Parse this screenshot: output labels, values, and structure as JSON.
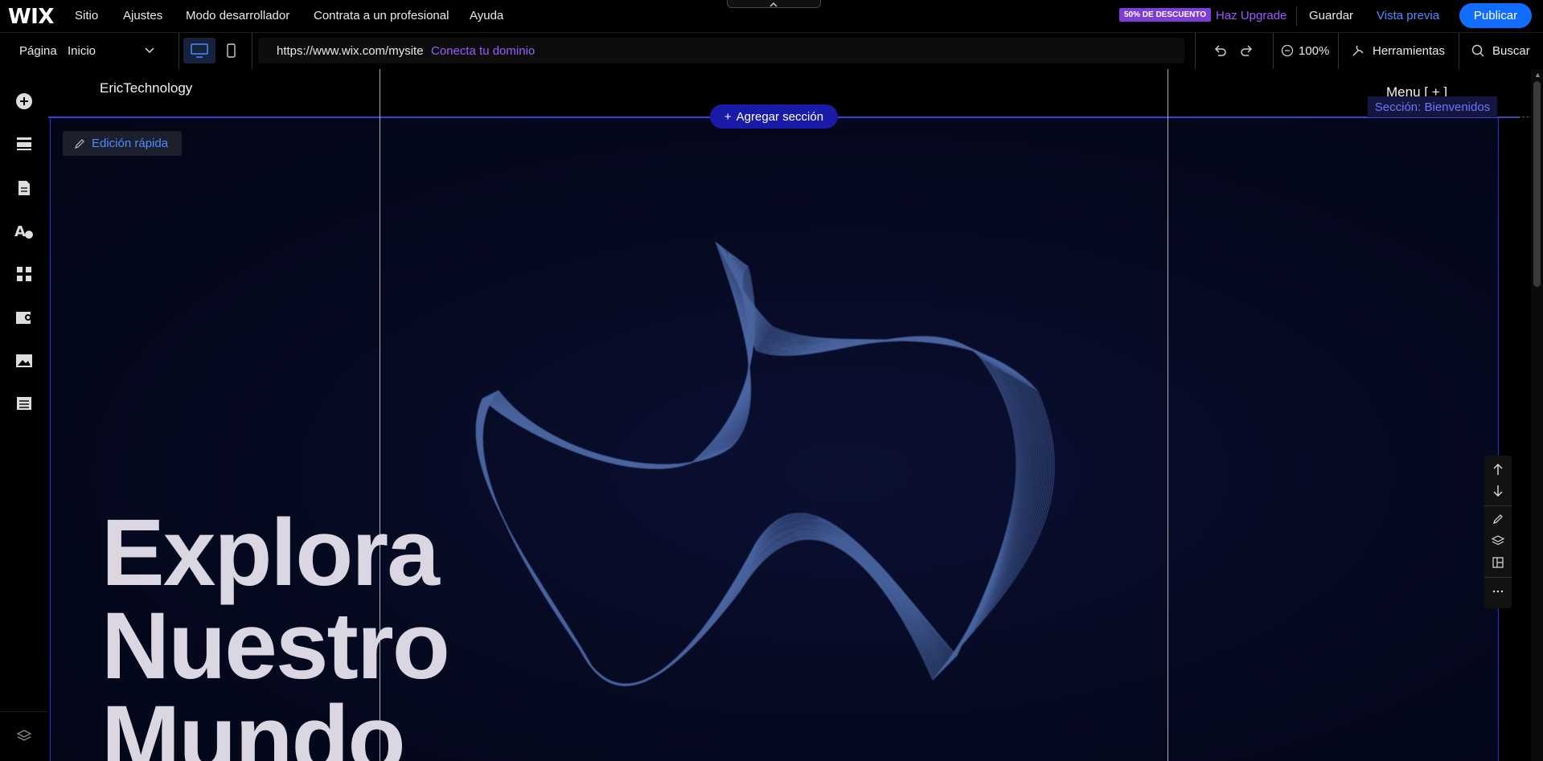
{
  "topbar": {
    "logo": "WIX",
    "menu": [
      "Sitio",
      "Ajustes",
      "Modo desarrollador",
      "Contrata a un profesional",
      "Ayuda"
    ],
    "discount_badge": "50% DE DESCUENTO",
    "upgrade": "Haz Upgrade",
    "save": "Guardar",
    "preview": "Vista previa",
    "publish": "Publicar"
  },
  "toolbar": {
    "page_label": "Página",
    "page_value": "Inicio",
    "url": "https://www.wix.com/mysite",
    "connect_domain": "Conecta tu dominio",
    "zoom": "100%",
    "tools": "Herramientas",
    "search": "Buscar"
  },
  "left_rail": {
    "icons": [
      "add-elements-icon",
      "sections-icon",
      "pages-icon",
      "design-icon",
      "apps-icon",
      "business-icon",
      "media-icon",
      "cms-icon",
      "layers-icon"
    ]
  },
  "canvas": {
    "brand": "EricTechnology",
    "menu_button": "Menu [ + ]",
    "add_section": "Agregar sección",
    "section_label": "Sección: Bienvenidos",
    "quick_edit": "Edición rápida",
    "hero_lines": [
      "Explora",
      "Nuestro",
      "Mundo"
    ]
  },
  "colors": {
    "accent_blue": "#116dff",
    "purple": "#9a5bff",
    "section_border": "#2a2fd0"
  }
}
